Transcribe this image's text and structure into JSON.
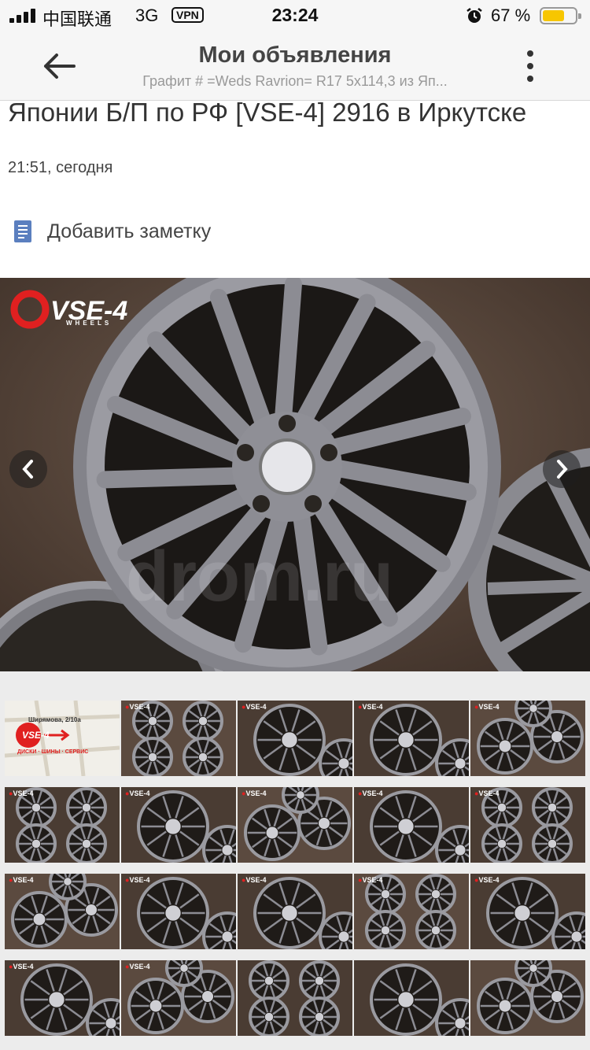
{
  "status_bar": {
    "carrier": "中国联通",
    "network": "3G",
    "vpn": "VPN",
    "time": "23:24",
    "battery_percent": "67 %",
    "battery_level": 0.67,
    "alarm_icon": "alarm-clock-icon"
  },
  "header": {
    "title": "Мои объявления",
    "subtitle": "Графит # =Weds Ravrion= R17 5x114,3 из Яп...",
    "back_icon": "arrow-left-icon",
    "menu_icon": "more-vertical-icon"
  },
  "listing": {
    "title_tail": "Японии Б/П по РФ [VSE-4] 2916 в Иркутске",
    "posted": "21:51, сегодня",
    "note_label": "Добавить заметку",
    "note_icon": "note-icon"
  },
  "photo": {
    "logo_text": "VSE-4",
    "logo_sub": "WHEELS",
    "watermark": "drom.ru",
    "prev_icon": "chevron-left-icon",
    "next_icon": "chevron-right-icon"
  },
  "gallery": {
    "map_thumb": {
      "street": "Ширямова, 2/10а",
      "caption": "ДИСКИ · ШИНЫ · СЕРВИС",
      "logo": "VSE-4"
    },
    "thumbnail_count": 20
  },
  "colors": {
    "accent_red": "#e02020",
    "battery": "#f7c600",
    "header_bg": "#f6f6f6"
  }
}
